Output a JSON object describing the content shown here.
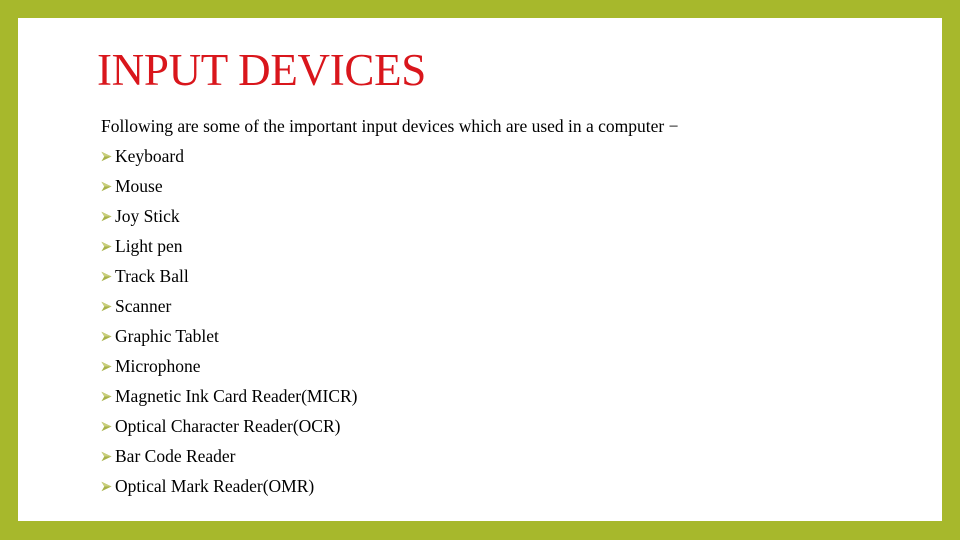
{
  "slide": {
    "title": "INPUT DEVICES",
    "intro": "Following are some of the important input devices which are used in a computer −",
    "bullet_icon": "arrowhead-bullet-icon",
    "colors": {
      "frame": "#a7b82c",
      "title": "#d9161c",
      "bullet": "#a8b24a",
      "text": "#000000"
    },
    "items": [
      {
        "label": "Keyboard"
      },
      {
        "label": "Mouse"
      },
      {
        "label": "Joy Stick"
      },
      {
        "label": "Light pen"
      },
      {
        "label": "Track Ball"
      },
      {
        "label": "Scanner"
      },
      {
        "label": "Graphic Tablet"
      },
      {
        "label": "Microphone"
      },
      {
        "label": "Magnetic Ink Card Reader(MICR)"
      },
      {
        "label": "Optical Character Reader(OCR)"
      },
      {
        "label": "Bar Code Reader"
      },
      {
        "label": "Optical Mark Reader(OMR)"
      }
    ]
  }
}
